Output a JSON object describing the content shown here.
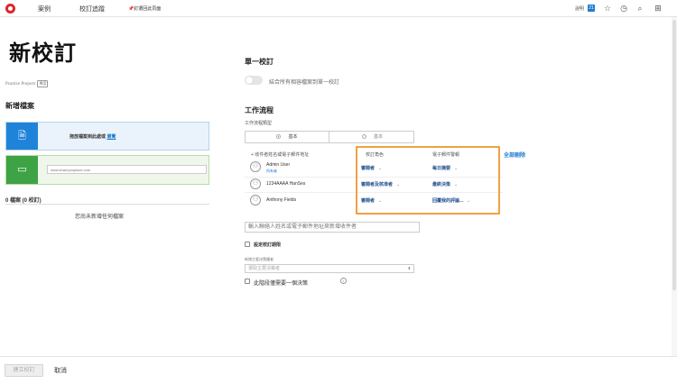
{
  "topbar": {
    "cases": "案例",
    "tracker": "校訂追蹤",
    "pinned": "釘選回此頁面",
    "help_label": "說明",
    "badge_count": "21"
  },
  "page": {
    "title": "新校訂",
    "project_name": "Practice Projects",
    "project_tag": "專案"
  },
  "left": {
    "new_file_heading": "新增檔案",
    "drop_text": "拖放檔案到此處或",
    "browse_link": "瀏覽",
    "url_placeholder": "www.shareyouplace.com",
    "files_count": "0 檔案 (0 校訂)",
    "no_files": "您尚未新增任何檔案"
  },
  "single_proof": {
    "heading": "單一校訂",
    "toggle_label": "結合所有相容檔案到單一校訂"
  },
  "workflow": {
    "heading": "工作流程",
    "type_label": "工作流程類型",
    "options": [
      "基本",
      "基本"
    ],
    "col_person": "+ 收件者姓名或電子郵件地址",
    "col_role": "校訂角色",
    "col_email": "電子郵件警報",
    "delete_all": "全部刪除",
    "rows": [
      {
        "name": "Admin User",
        "sub": "所有者",
        "role": "審閱者",
        "email": "每日摘要"
      },
      {
        "name": "1234AAAA HanSes",
        "sub": "",
        "role": "審閱者及核准者",
        "email": "最終決策"
      },
      {
        "name": "Anthony Fields",
        "sub": "",
        "role": "審閱者",
        "email": "回覆我的評論..."
      }
    ],
    "add_recipient": "輸入聯絡人姓名或電子郵件地址來新增收件者",
    "deadline_label": "設定校訂期限",
    "primary_label": "新增主要決策權者",
    "primary_placeholder": "選取主要決策者",
    "one_decision_label": "此階段僅需要一個決策",
    "info_icon_glyph": "i"
  },
  "footer": {
    "create": "建立校訂",
    "cancel": "取消"
  }
}
